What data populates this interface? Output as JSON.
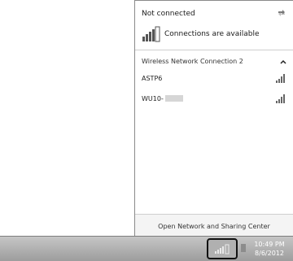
{
  "flyout": {
    "status": "Not connected",
    "connections_label": "Connections are available",
    "section_title": "Wireless Network Connection 2",
    "networks": [
      {
        "ssid": "ASTP6"
      },
      {
        "ssid": "WU10-"
      }
    ],
    "footer_link": "Open Network and Sharing Center"
  },
  "taskbar": {
    "time": "10:49 PM",
    "date": "8/6/2012"
  }
}
